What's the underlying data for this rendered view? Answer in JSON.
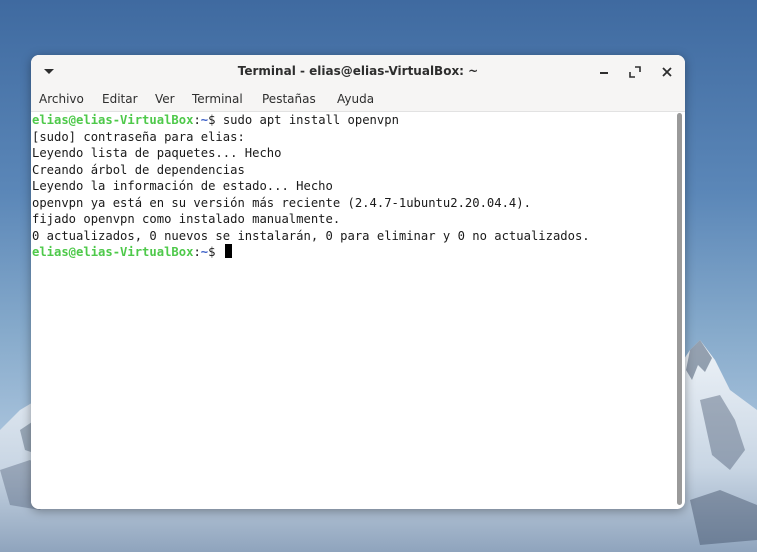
{
  "window": {
    "title": "Terminal - elias@elias-VirtualBox: ~",
    "controls": [
      "minimize-icon",
      "maximize-icon",
      "close-icon"
    ]
  },
  "menubar": {
    "items": [
      "Archivo",
      "Editar",
      "Ver",
      "Terminal",
      "Pestañas",
      "Ayuda"
    ]
  },
  "terminal": {
    "prompt_user": "elias@elias-VirtualBox",
    "prompt_sep": ":",
    "prompt_path": "~",
    "prompt_sign": "$ ",
    "command": "sudo apt install openvpn",
    "output": [
      "[sudo] contraseña para elias:",
      "Leyendo lista de paquetes... Hecho",
      "Creando árbol de dependencias",
      "Leyendo la información de estado... Hecho",
      "openvpn ya está en su versión más reciente (2.4.7-1ubuntu2.20.04.4).",
      "fijado openvpn como instalado manualmente.",
      "0 actualizados, 0 nuevos se instalarán, 0 para eliminar y 0 no actualizados."
    ]
  },
  "colors": {
    "prompt_user": "#4ec94a",
    "prompt_path": "#3f62c8",
    "terminal_bg": "#ffffff",
    "titlebar_bg": "#f6f5f4"
  }
}
